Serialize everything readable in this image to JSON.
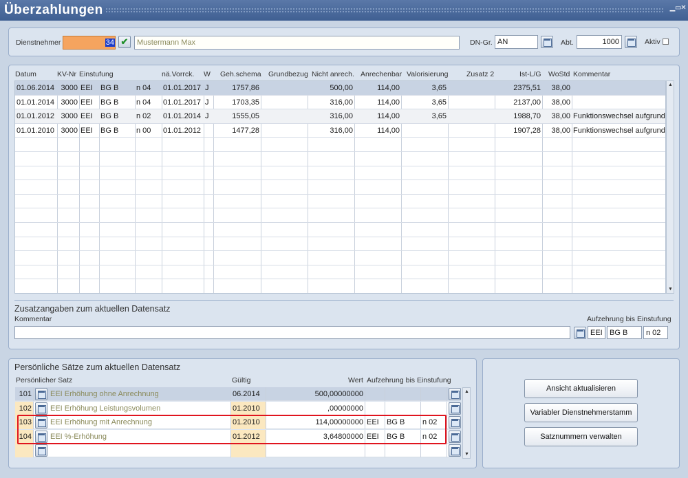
{
  "window": {
    "title": "Überzahlungen"
  },
  "header": {
    "dienstnehmer_label": "Dienstnehmer",
    "dienstnehmer_value": "34",
    "dienstnehmer_name": "Mustermann Max",
    "dngr_label": "DN-Gr.",
    "dngr_value": "AN",
    "abt_label": "Abt.",
    "abt_value": "1000",
    "aktiv_label": "Aktiv"
  },
  "grid": {
    "columns": [
      "Datum",
      "KV-Nr",
      "Einstufung",
      "nä.Vorrck.",
      "W",
      "Geh.schema",
      "Grundbezug",
      "Nicht anrech.",
      "Anrechenbar",
      "Valorisierung",
      "Zusatz 2",
      "Ist-L/G",
      "WoStd",
      "Kommentar"
    ],
    "rows": [
      {
        "datum": "01.06.2014",
        "kv": "3000",
        "e1": "EEI",
        "e2": "BG B",
        "e3": "n 04",
        "vorr": "01.01.2017",
        "w": "J",
        "geh": "1757,86",
        "grund": "",
        "nicht": "500,00",
        "anr": "114,00",
        "val": "3,65",
        "zus": "",
        "ist": "2375,51",
        "wo": "38,00",
        "komm": ""
      },
      {
        "datum": "01.01.2014",
        "kv": "3000",
        "e1": "EEI",
        "e2": "BG B",
        "e3": "n 04",
        "vorr": "01.01.2017",
        "w": "J",
        "geh": "1703,35",
        "grund": "",
        "nicht": "316,00",
        "anr": "114,00",
        "val": "3,65",
        "zus": "",
        "ist": "2137,00",
        "wo": "38,00",
        "komm": ""
      },
      {
        "datum": "01.01.2012",
        "kv": "3000",
        "e1": "EEI",
        "e2": "BG B",
        "e3": "n 02",
        "vorr": "01.01.2014",
        "w": "J",
        "geh": "1555,05",
        "grund": "",
        "nicht": "316,00",
        "anr": "114,00",
        "val": "3,65",
        "zus": "",
        "ist": "1988,70",
        "wo": "38,00",
        "komm": "Funktionswechsel aufgrund"
      },
      {
        "datum": "01.01.2010",
        "kv": "3000",
        "e1": "EEI",
        "e2": "BG B",
        "e3": "n 00",
        "vorr": "01.01.2012",
        "w": "",
        "geh": "1477,28",
        "grund": "",
        "nicht": "316,00",
        "anr": "114,00",
        "val": "",
        "zus": "",
        "ist": "1907,28",
        "wo": "38,00",
        "komm": "Funktionswechsel aufgrund"
      }
    ]
  },
  "zusatz": {
    "title": "Zusatzangaben zum aktuellen Datensatz",
    "kommentar_label": "Kommentar",
    "kommentar_value": "",
    "aufzehrung_label": "Aufzehrung bis Einstufung",
    "aufz1": "EEI",
    "aufz2": "BG B",
    "aufz3": "n 02"
  },
  "persoenlich": {
    "title": "Persönliche Sätze zum aktuellen Datensatz",
    "col_satz": "Persönlicher Satz",
    "col_gueltig": "Gültig",
    "col_wert": "Wert",
    "col_aufz": "Aufzehrung bis Einstufung",
    "rows": [
      {
        "nr": "101",
        "name": "EEI Erhöhung ohne Anrechnung",
        "gueltig": "06.2014",
        "wert": "500,00000000",
        "a1": "",
        "a2": "",
        "a3": ""
      },
      {
        "nr": "102",
        "name": "EEI Erhöhung Leistungsvolumen",
        "gueltig": "01.2010",
        "wert": ",00000000",
        "a1": "",
        "a2": "",
        "a3": ""
      },
      {
        "nr": "103",
        "name": "EEI Erhöhung mit Anrechnung",
        "gueltig": "01.2010",
        "wert": "114,00000000",
        "a1": "EEI",
        "a2": "BG B",
        "a3": "n 02"
      },
      {
        "nr": "104",
        "name": "EEI %-Erhöhung",
        "gueltig": "01.2012",
        "wert": "3,64800000",
        "a1": "EEI",
        "a2": "BG B",
        "a3": "n 02"
      },
      {
        "nr": "",
        "name": "",
        "gueltig": "",
        "wert": "",
        "a1": "",
        "a2": "",
        "a3": ""
      }
    ]
  },
  "buttons": {
    "ansicht": "Ansicht aktualisieren",
    "variabler": "Variabler Dienstnehmerstamm",
    "satznummern": "Satznummern verwalten"
  },
  "colors": {
    "title_bar": "#4a6a9c",
    "selected_row": "#c8d3e3",
    "highlight_box": "#e0141e",
    "dn_field": "#f5a45f"
  }
}
